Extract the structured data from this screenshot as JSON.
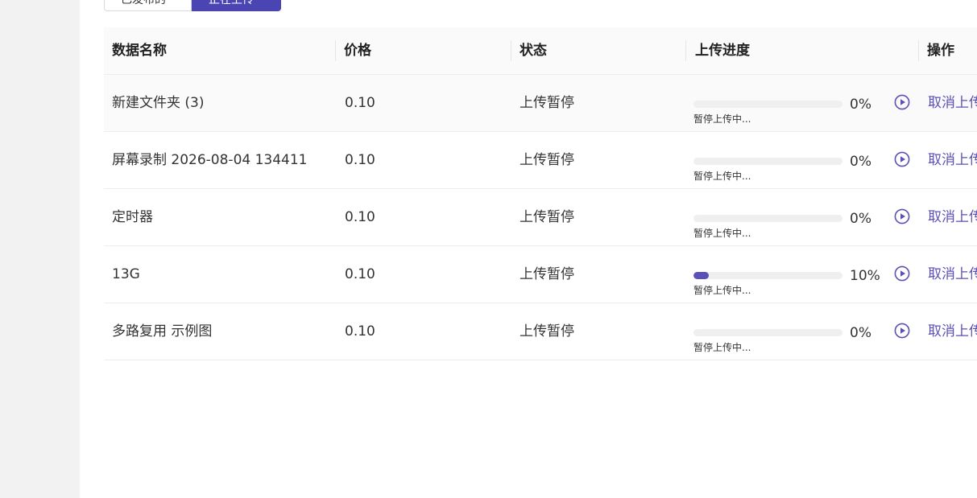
{
  "tabs": [
    {
      "label": "已发布的"
    },
    {
      "label": "正在上传"
    }
  ],
  "table": {
    "headers": {
      "name": "数据名称",
      "price": "价格",
      "status": "状态",
      "progress": "上传进度",
      "actions": "操作"
    },
    "rows": [
      {
        "name": "新建文件夹 (3)",
        "price": "0.10",
        "status": "上传暂停",
        "progress": 0,
        "percent_label": "0%",
        "note": "暂停上传中...",
        "action": "取消上传"
      },
      {
        "name": "屏幕录制 2026-08-04 134411",
        "price": "0.10",
        "status": "上传暂停",
        "progress": 0,
        "percent_label": "0%",
        "note": "暂停上传中...",
        "action": "取消上传"
      },
      {
        "name": "定时器",
        "price": "0.10",
        "status": "上传暂停",
        "progress": 0,
        "percent_label": "0%",
        "note": "暂停上传中...",
        "action": "取消上传"
      },
      {
        "name": "13G",
        "price": "0.10",
        "status": "上传暂停",
        "progress": 0.1,
        "percent_label": "10%",
        "note": "暂停上传中...",
        "action": "取消上传"
      },
      {
        "name": "多路复用 示例图",
        "price": "0.10",
        "status": "上传暂停",
        "progress": 0,
        "percent_label": "0%",
        "note": "暂停上传中...",
        "action": "取消上传"
      }
    ]
  },
  "colors": {
    "accent": "#5b50b5",
    "tab_active": "#4b45b4",
    "rail": "#f2f2f2"
  },
  "icons": {
    "resume": "play-circle-icon"
  }
}
